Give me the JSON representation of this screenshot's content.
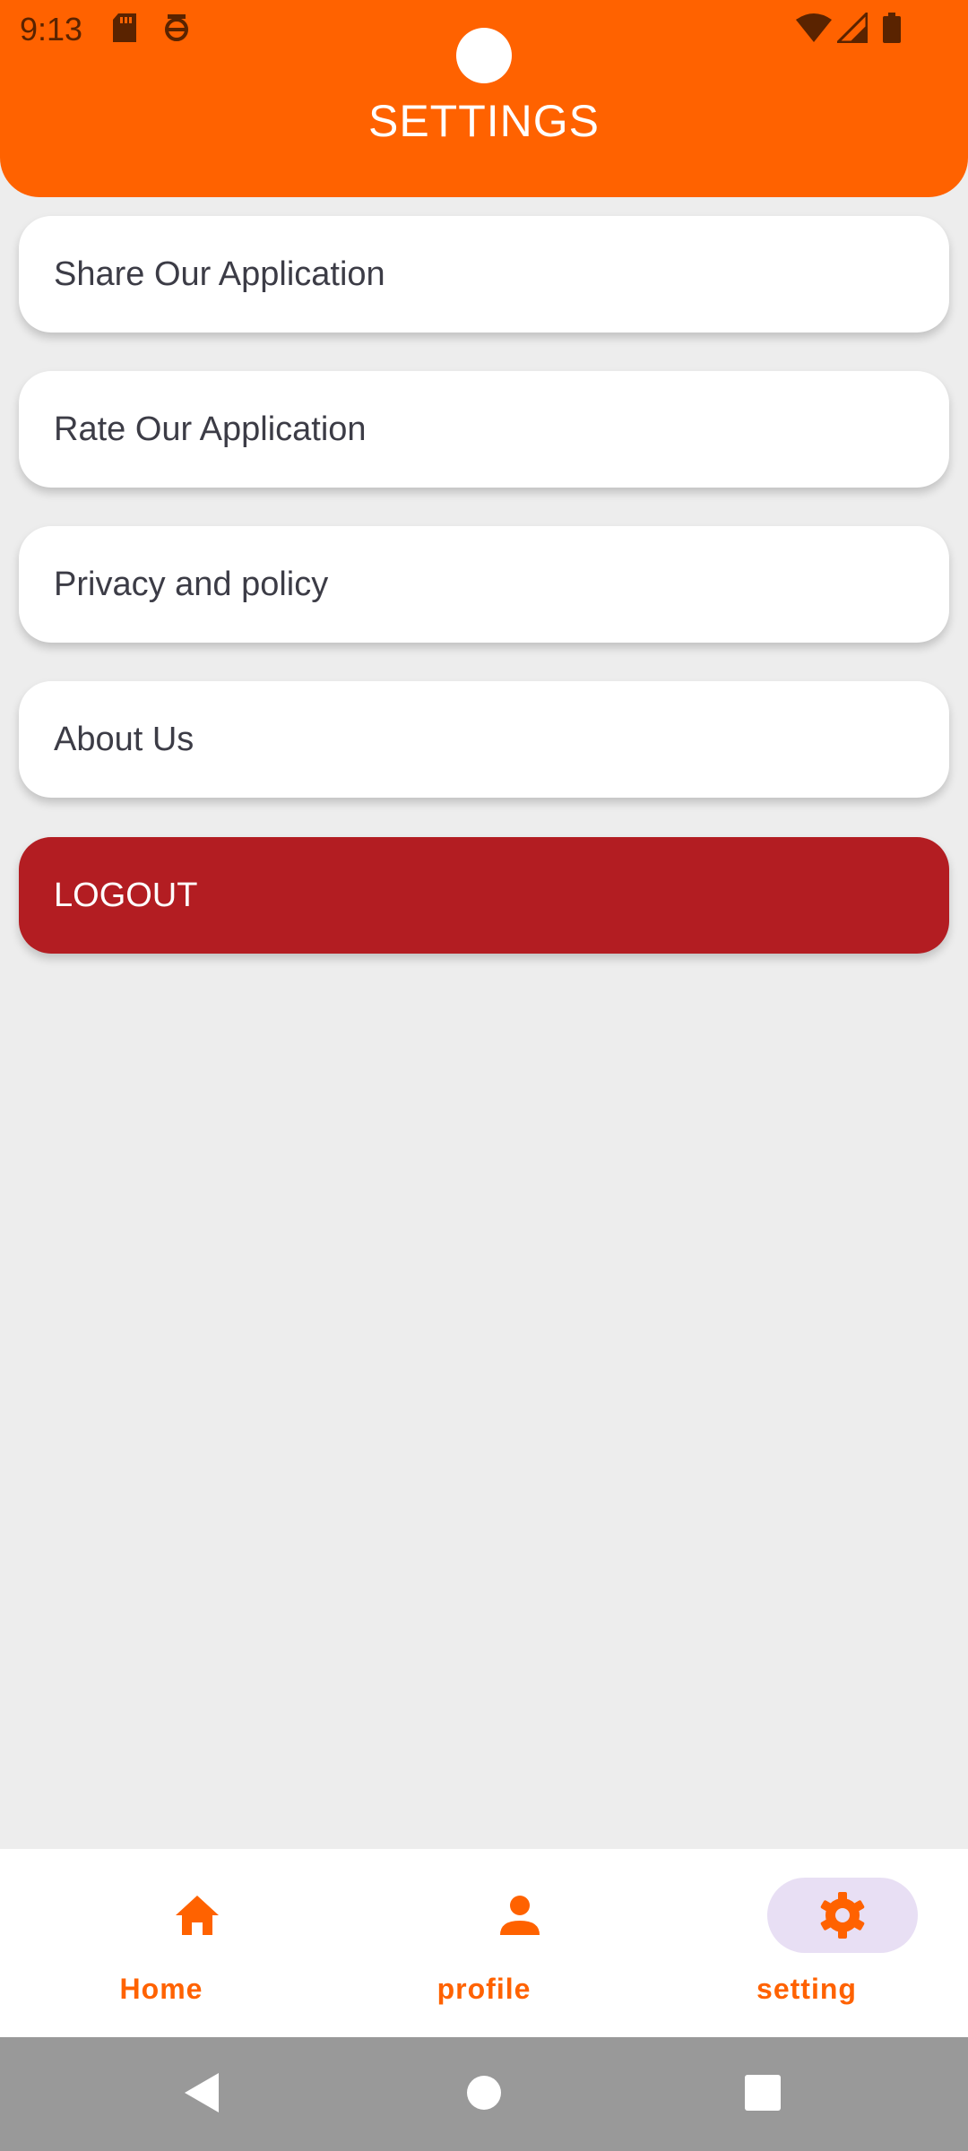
{
  "status_bar": {
    "time": "9:13"
  },
  "header": {
    "title": "SETTINGS"
  },
  "menu": {
    "items": [
      {
        "label": "Share Our Application"
      },
      {
        "label": "Rate Our Application"
      },
      {
        "label": "Privacy and policy"
      },
      {
        "label": "About Us"
      }
    ],
    "logout_label": "LOGOUT"
  },
  "bottom_nav": {
    "items": [
      {
        "label": "Home",
        "icon": "home-icon",
        "active": false
      },
      {
        "label": "profile",
        "icon": "person-icon",
        "active": false
      },
      {
        "label": "setting",
        "icon": "gear-icon",
        "active": true
      }
    ]
  },
  "colors": {
    "accent": "#ff6200",
    "logout": "#b31d22",
    "background": "#ededed",
    "active_pill": "#e8dff4"
  }
}
